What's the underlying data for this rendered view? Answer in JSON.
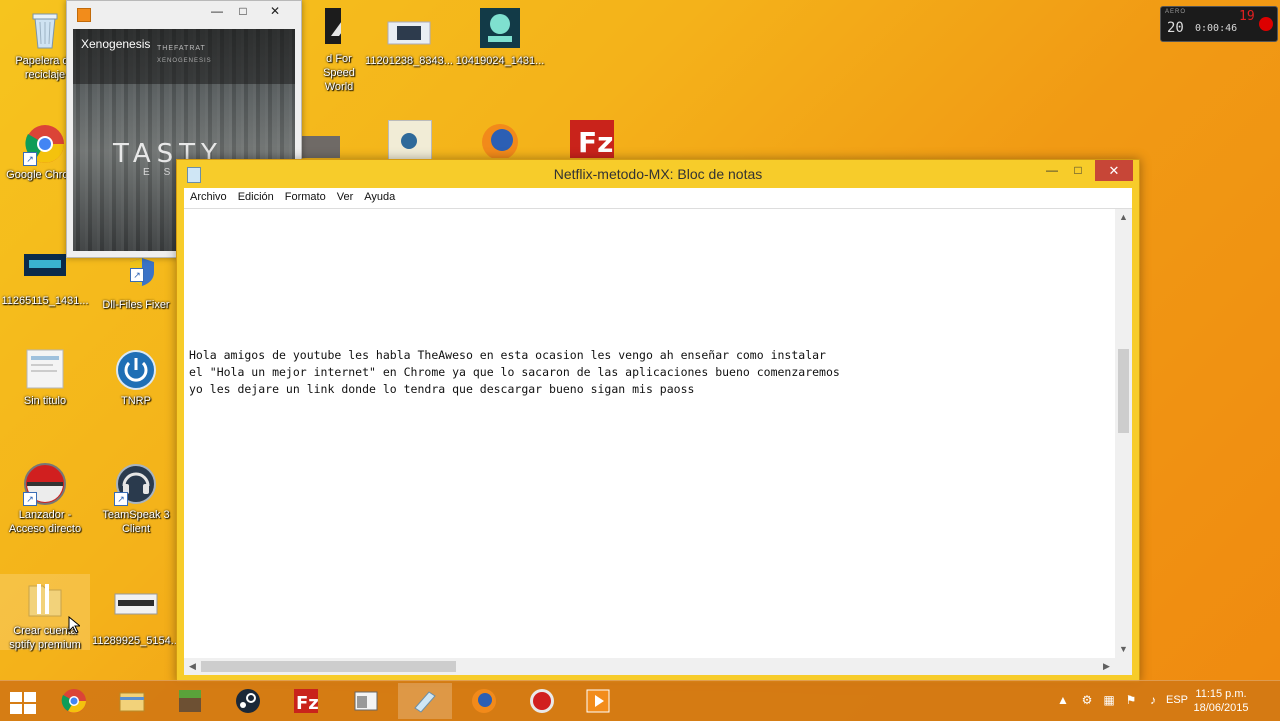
{
  "desktop": {
    "icons": [
      {
        "label": "Papelera de reciclaje"
      },
      {
        "label": "Google Chrome"
      },
      {
        "label": "11265115_1431..."
      },
      {
        "label": "Sin titulo"
      },
      {
        "label": "Lanzador - Acceso directo"
      },
      {
        "label": "Crear cuenta sptify premium"
      },
      {
        "label": "Dll-Files Fixer"
      },
      {
        "label": "TNRP"
      },
      {
        "label": "TeamSpeak 3 Client"
      },
      {
        "label": "11289925_5154..."
      },
      {
        "label": "d For Speed World"
      },
      {
        "label": "11201238_8343..."
      },
      {
        "label": "10419024_1431..."
      }
    ]
  },
  "widget": {
    "label": "AERO",
    "left_value": "20",
    "time": "0:00:46",
    "right_value": "19"
  },
  "player": {
    "track_title": "Xenogenesis",
    "artist": "THEFATRAT",
    "album_sub": "XENOGENESIS",
    "art_big_text": "TASTY",
    "art_small_text": "EST"
  },
  "notepad": {
    "title": "Netflix-metodo-MX: Bloc de notas",
    "menu": [
      "Archivo",
      "Edición",
      "Formato",
      "Ver",
      "Ayuda"
    ],
    "lines": [
      "Hola amigos de youtube les habla TheAweso en esta ocasion les vengo ah enseñar como instalar",
      "el \"Hola un mejor internet\" en Chrome ya que lo sacaron de las aplicaciones bueno comenzaremos",
      "yo les dejare un link donde lo tendra que descargar bueno sigan mis paoss"
    ]
  },
  "taskbar": {
    "apps": [
      "start",
      "chrome",
      "file-explorer",
      "minecraft",
      "steam",
      "filezilla",
      "notepad-window",
      "notepad",
      "firefox",
      "record",
      "media-player"
    ],
    "language": "ESP",
    "time": "11:15 p.m.",
    "date": "18/06/2015"
  },
  "colors": {
    "desktop_bg": "#f4b21a",
    "close_button": "#c74637",
    "notepad_frame": "#f7cc2a"
  }
}
